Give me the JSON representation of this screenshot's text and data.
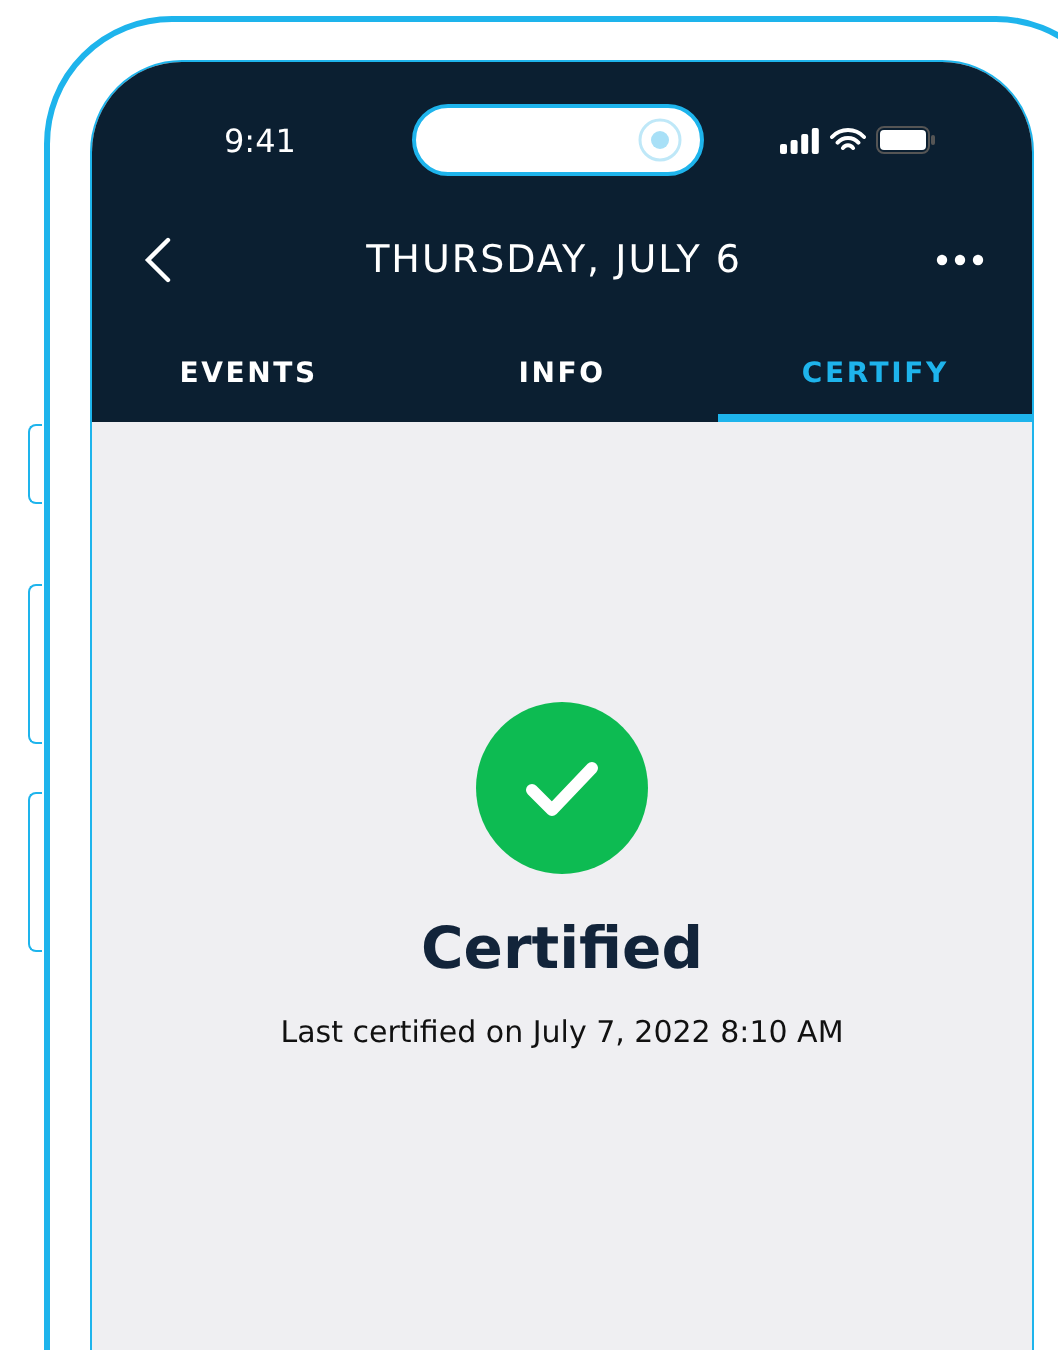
{
  "status_bar": {
    "time": "9:41"
  },
  "header": {
    "title": "THURSDAY, JULY 6"
  },
  "tabs": [
    {
      "label": "EVENTS",
      "selected": false
    },
    {
      "label": "INFO",
      "selected": false
    },
    {
      "label": "CERTIFY",
      "selected": true
    }
  ],
  "certification": {
    "certified": true,
    "heading": "Certified",
    "detail": "Last certified on July 7, 2022 8:10 AM"
  }
}
